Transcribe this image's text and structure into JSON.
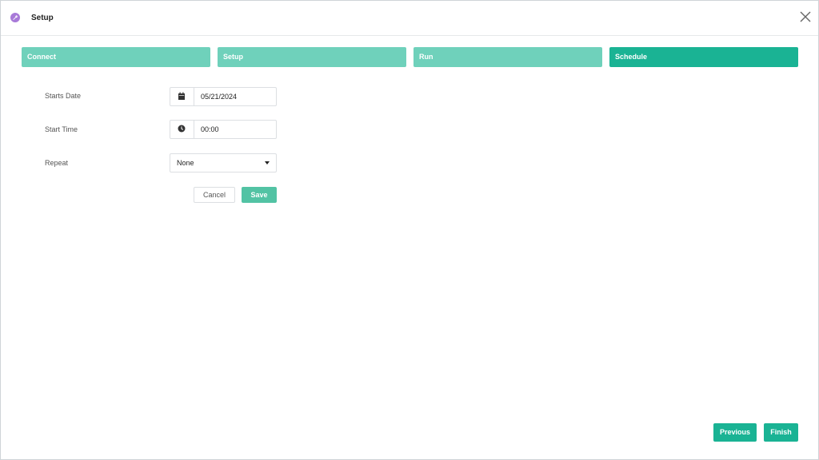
{
  "window": {
    "title": "Setup",
    "icon": "wrench-icon",
    "accent_color": "#a87ad8"
  },
  "steps": [
    {
      "label": "Connect",
      "active": false
    },
    {
      "label": "Setup",
      "active": false
    },
    {
      "label": "Run",
      "active": false
    },
    {
      "label": "Schedule",
      "active": true
    }
  ],
  "form": {
    "start_date": {
      "label": "Starts Date",
      "value": "05/21/2024",
      "icon": "calendar-icon"
    },
    "start_time": {
      "label": "Start Time",
      "value": "00:00",
      "icon": "clock-icon"
    },
    "repeat": {
      "label": "Repeat",
      "value": "None"
    },
    "cancel_label": "Cancel",
    "save_label": "Save"
  },
  "footer": {
    "previous_label": "Previous",
    "finish_label": "Finish"
  },
  "colors": {
    "step_inactive": "#6fd1bb",
    "step_active": "#1ab394",
    "primary": "#1ab394"
  }
}
